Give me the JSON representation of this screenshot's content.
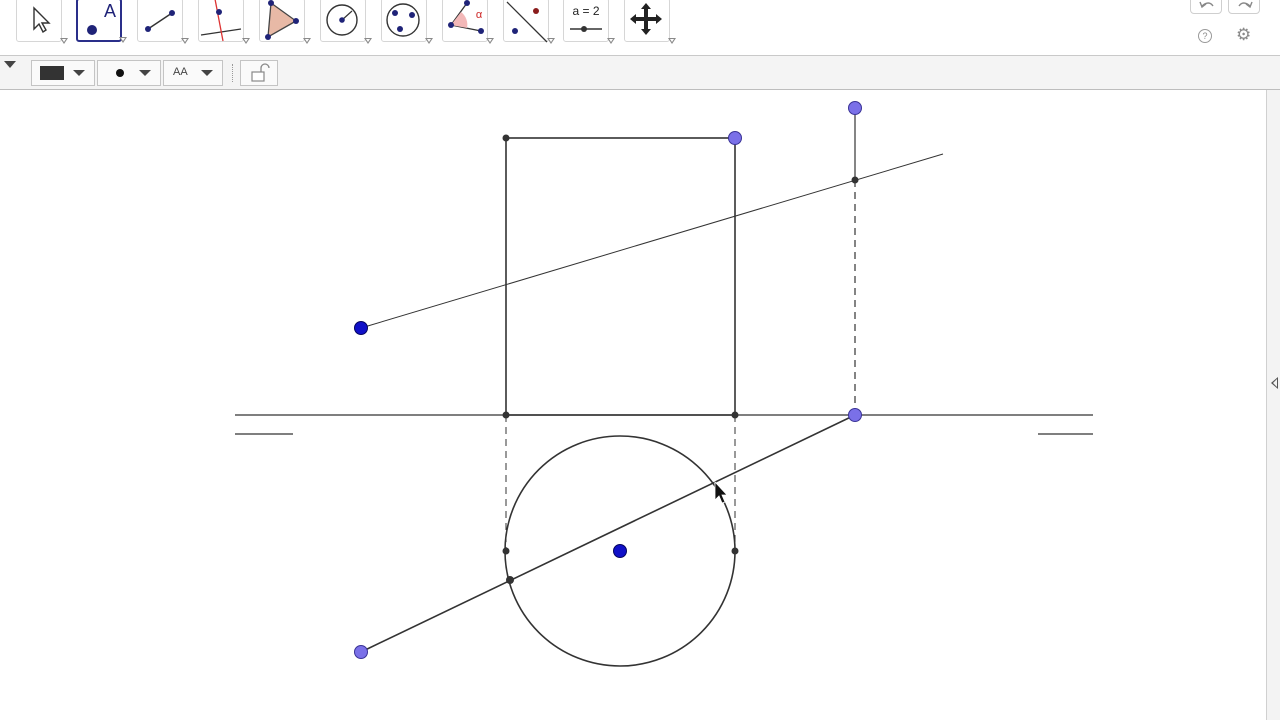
{
  "toolbar": {
    "tools": [
      {
        "name": "move-tool",
        "label": "",
        "selected": false
      },
      {
        "name": "point-tool",
        "label": "A",
        "selected": true
      },
      {
        "name": "segment-tool",
        "label": "",
        "selected": false
      },
      {
        "name": "perpendicular-line-tool",
        "label": "",
        "selected": false
      },
      {
        "name": "polygon-tool",
        "label": "",
        "selected": false
      },
      {
        "name": "circle-center-point-tool",
        "label": "",
        "selected": false
      },
      {
        "name": "circle-three-points-tool",
        "label": "",
        "selected": false
      },
      {
        "name": "angle-tool",
        "label": "α",
        "selected": false
      },
      {
        "name": "reflect-about-line-tool",
        "label": "",
        "selected": false
      },
      {
        "name": "slider-tool",
        "label": "a = 2",
        "selected": false
      },
      {
        "name": "move-graphics-view-tool",
        "label": "",
        "selected": false
      }
    ],
    "undo_icon": "undo-icon",
    "redo_icon": "redo-icon",
    "help_label": "?",
    "settings_icon": "gear-icon"
  },
  "stylebar": {
    "color_value": "#333333",
    "point_style": "filled-dot",
    "text_label": "AA",
    "lock_icon": "unlock-icon"
  },
  "colors": {
    "free_point": "#1010c8",
    "dependent_point": "#7a70e8",
    "intersection_point": "#333333",
    "line": "#333333",
    "selected_tool_border": "#2a2f8a"
  }
}
